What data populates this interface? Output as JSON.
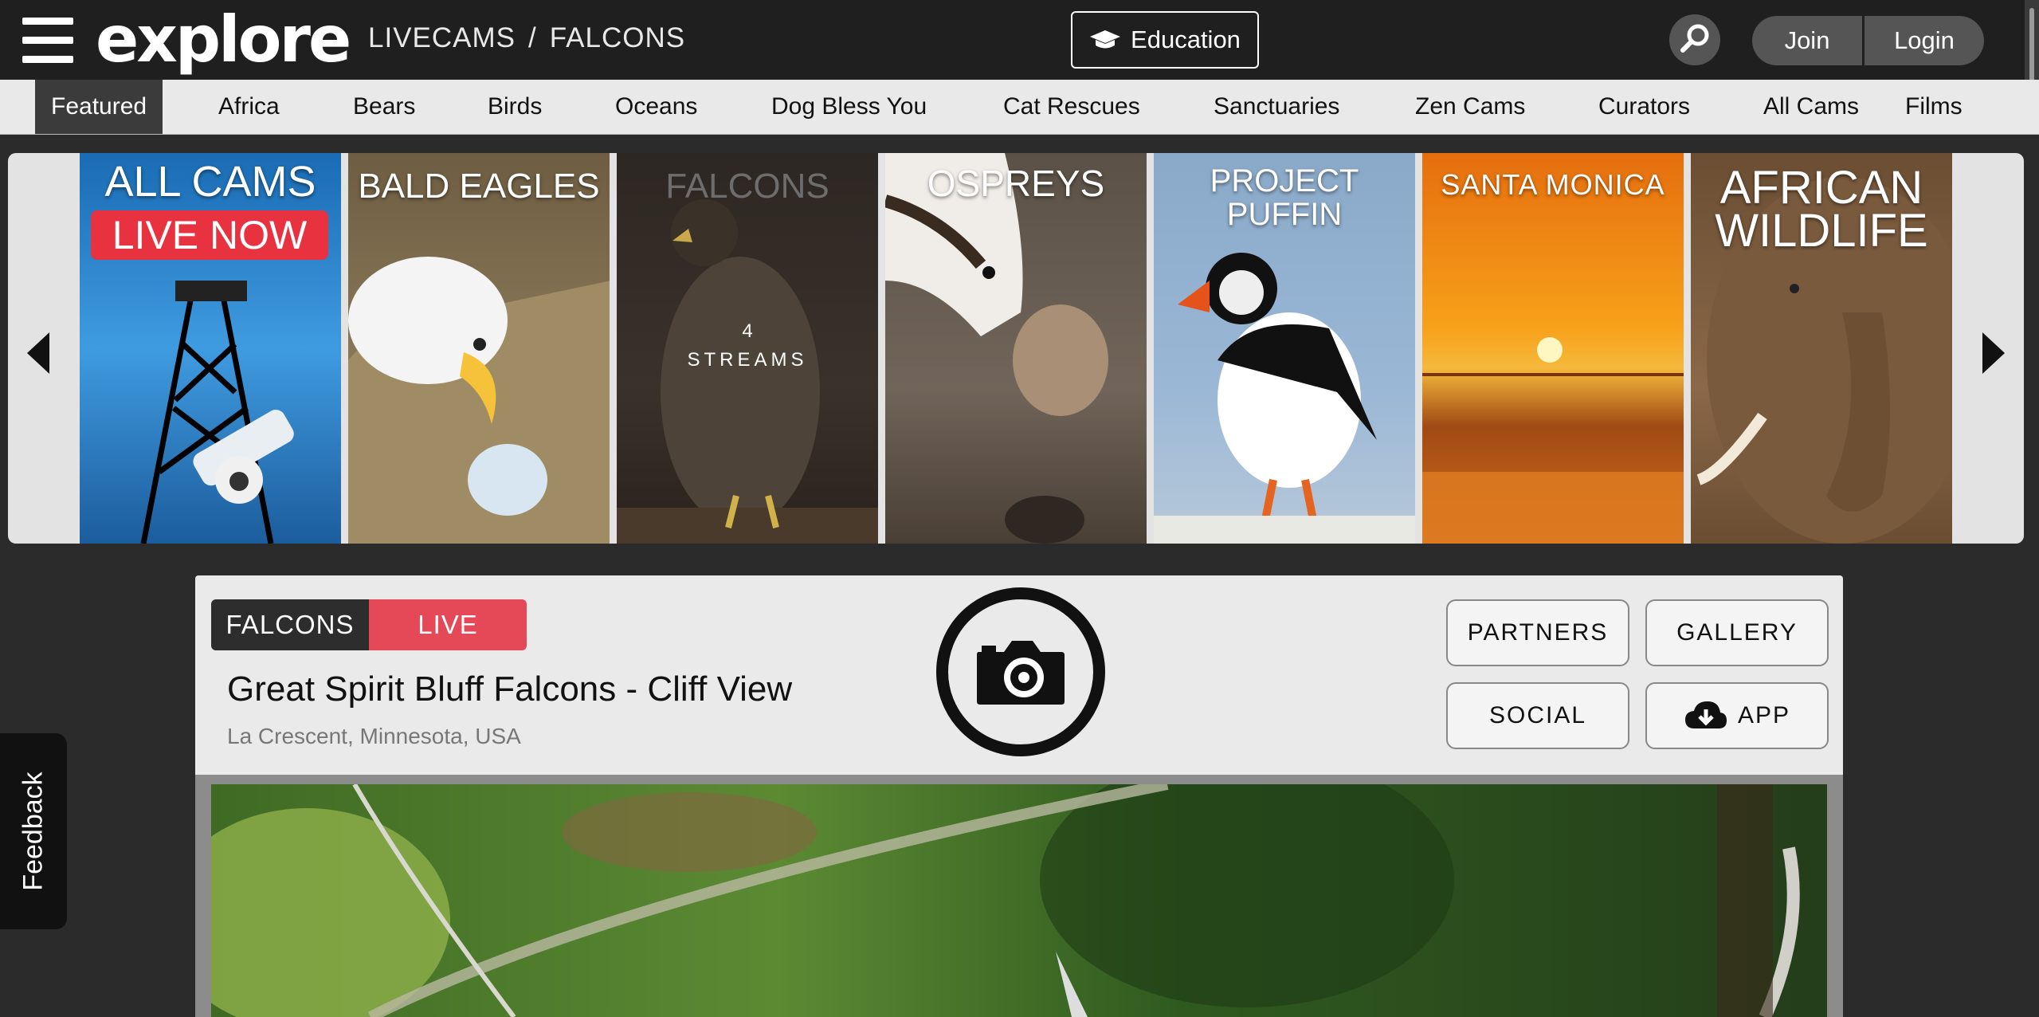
{
  "header": {
    "logo_text": "explore",
    "breadcrumb": [
      "LIVECAMS",
      "FALCONS"
    ],
    "breadcrumb_separator": "/",
    "education_label": "Education",
    "join_label": "Join",
    "login_label": "Login"
  },
  "nav": {
    "items": [
      "Featured",
      "Africa",
      "Bears",
      "Birds",
      "Oceans",
      "Dog Bless You",
      "Cat Rescues",
      "Sanctuaries",
      "Zen Cams",
      "Curators",
      "All Cams",
      "Films"
    ],
    "active": "Featured"
  },
  "carousel": {
    "tiles": [
      {
        "title_line1": "ALL CAMS",
        "badge": "LIVE NOW"
      },
      {
        "title_line1": "BALD EAGLES"
      },
      {
        "title_line1": "FALCONS",
        "stream_count": "4",
        "stream_label": "STREAMS"
      },
      {
        "title_line1": "OSPREYS"
      },
      {
        "title_line1": "PROJECT",
        "title_line2": "PUFFIN"
      },
      {
        "title_line1": "SANTA MONICA"
      },
      {
        "title_line1": "AFRICAN",
        "title_line2": "WILDLIFE"
      }
    ]
  },
  "cam": {
    "category_tag": "FALCONS",
    "live_tag": "LIVE",
    "title": "Great Spirit Bluff Falcons - Cliff View",
    "location": "La Crescent, Minnesota, USA",
    "buttons": {
      "partners": "PARTNERS",
      "gallery": "GALLERY",
      "social": "SOCIAL",
      "app": "APP"
    }
  },
  "feedback_label": "Feedback",
  "colors": {
    "header_bg": "#1f1f1f",
    "nav_bg": "#e9e9e9",
    "live_red": "#e54856",
    "badge_red": "#e8323f",
    "page_bg": "#2b2b2b"
  }
}
